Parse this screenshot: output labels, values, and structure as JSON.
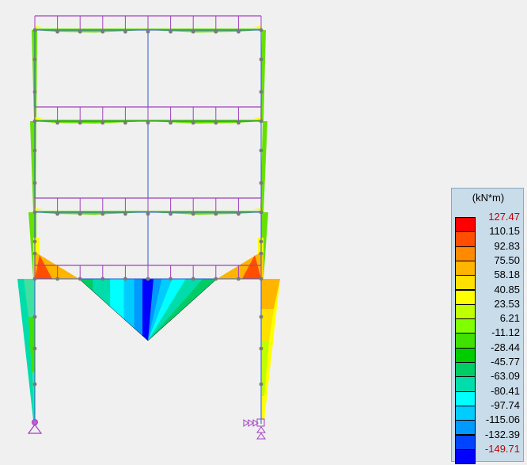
{
  "legend": {
    "unit": "(kN*m)",
    "labels": [
      "127.47",
      "110.15",
      "92.83",
      "75.50",
      "58.18",
      "40.85",
      "23.53",
      "6.21",
      "-11.12",
      "-28.44",
      "-45.77",
      "-63.09",
      "-80.41",
      "-97.74",
      "-115.06",
      "-132.39",
      "-149.71"
    ],
    "colors": [
      "#ff0000",
      "#ff4e00",
      "#ff8a00",
      "#ffb400",
      "#ffe000",
      "#ffff00",
      "#bfff00",
      "#80ff00",
      "#40e000",
      "#00cc00",
      "#00cc66",
      "#00ddaa",
      "#00ffff",
      "#00ccff",
      "#0099ff",
      "#0044ff",
      "#0000ff"
    ],
    "max_color": "#c00000"
  },
  "diagram": {
    "load_color": "#a040c0",
    "frame_color": "#2a5cd0",
    "node_color": "#7a7a7a"
  }
}
